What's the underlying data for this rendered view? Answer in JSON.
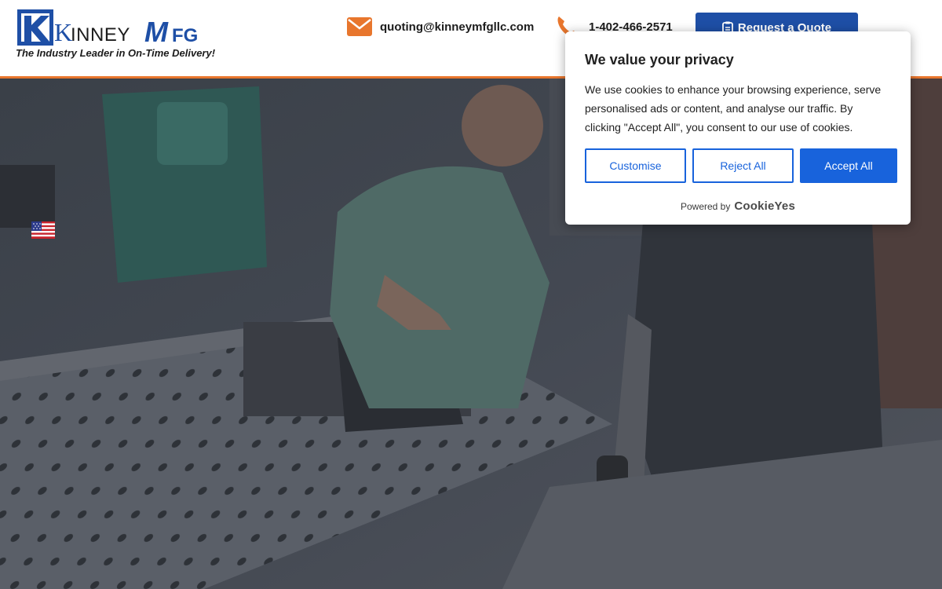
{
  "header": {
    "logo_text": "KinneyMfg",
    "tagline": "The Industry Leader in On-Time Delivery!",
    "email": "quoting@kinneymfgllc.com",
    "phone": "1-402-466-2571",
    "quote_button": "Request a Quote"
  },
  "icons": {
    "email": "envelope-icon",
    "phone": "phone-icon",
    "quote": "clipboard-icon",
    "flag": "us-flag-icon"
  },
  "cookie_banner": {
    "title": "We value your privacy",
    "description": "We use cookies to enhance your browsing experience, serve personalised ads or content, and analyse our traffic. By clicking \"Accept All\", you consent to our use of cookies.",
    "customise": "Customise",
    "reject": "Reject All",
    "accept": "Accept All",
    "powered_by": "Powered by",
    "brand": "CookieYes"
  },
  "colors": {
    "brand_blue": "#1e4fa6",
    "accent_orange": "#e8762d",
    "cookie_blue": "#1863dc"
  }
}
